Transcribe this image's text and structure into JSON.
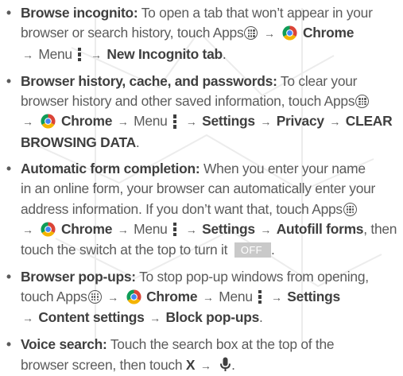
{
  "bullet": "•",
  "arrow": "→",
  "apps_label": "Apps",
  "chrome_label": "Chrome",
  "menu_label": "Menu",
  "items": [
    {
      "title": "Browse incognito:",
      "text_1": "To open a tab that won’t appear in your",
      "text_2": "browser or search history, touch",
      "new_incognito_tab": "New Incognito tab",
      "period": "."
    },
    {
      "title": "Browser history, cache, and passwords:",
      "text_1": "To clear your",
      "text_2": "browser history and other saved information, touch",
      "settings": "Settings",
      "privacy": "Privacy",
      "clear_browsing_data_1": "CLEAR",
      "clear_browsing_data_2": "BROWSING DATA",
      "period": "."
    },
    {
      "title": "Automatic form completion:",
      "text_1": "When you enter your name",
      "text_2": "in an online form, your browser can automatically enter your",
      "text_3": "address information. If you don’t want that, touch",
      "settings": "Settings",
      "autofill_forms": "Autofill forms",
      "text_4": ", then",
      "text_5": "touch the switch at the top to turn it",
      "switch_off": "OFF",
      "period": "."
    },
    {
      "title": "Browser pop-ups:",
      "text_1": "To stop pop-up windows from opening,",
      "text_2": "touch",
      "settings": "Settings",
      "content_settings": "Content settings",
      "block_popups": "Block pop-ups",
      "period": "."
    },
    {
      "title": "Voice search:",
      "text_1": "Touch the search box at the top of the",
      "text_2": "browser screen, then touch",
      "x_label": "X",
      "period": "."
    }
  ],
  "icons": {
    "apps": "apps-icon",
    "chrome": "chrome-icon",
    "menu": "menu-icon",
    "mic": "microphone-icon"
  }
}
